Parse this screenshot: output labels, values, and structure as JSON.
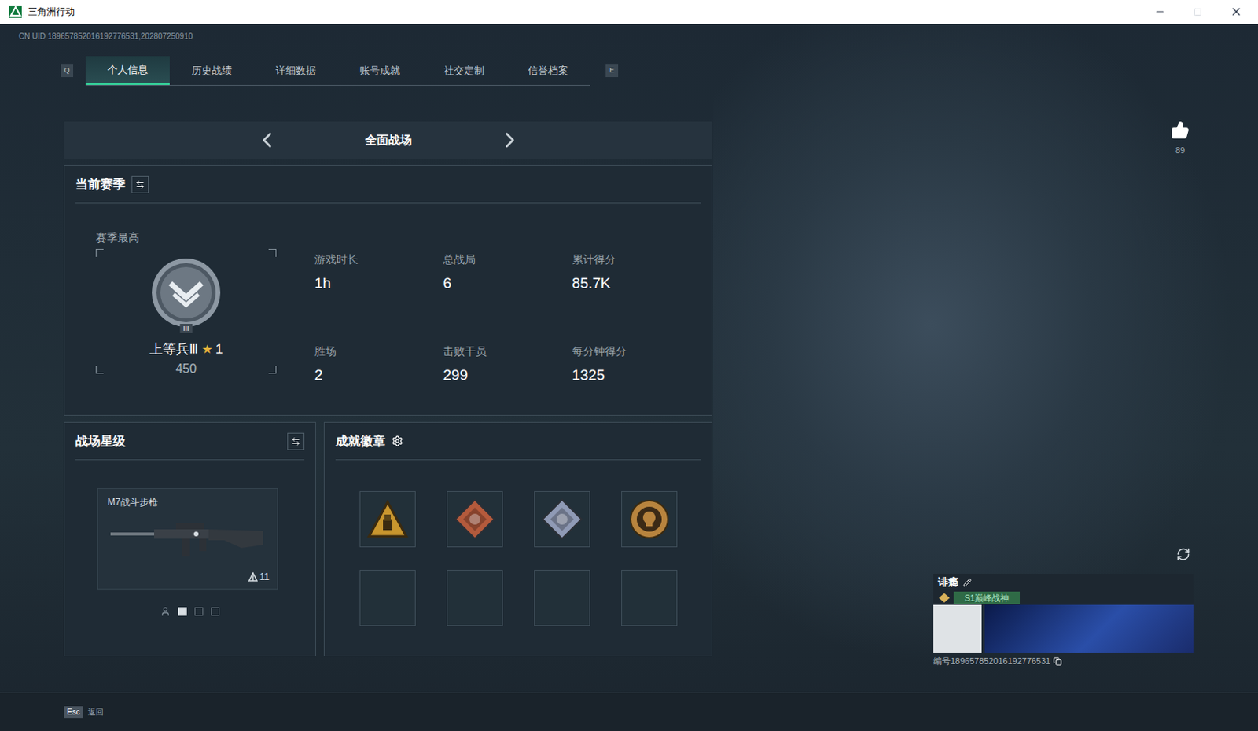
{
  "window": {
    "title": "三角洲行动"
  },
  "uid": "CN UID 189657852016192776531,202807250910",
  "tabs": {
    "prev_key": "Q",
    "next_key": "E",
    "items": [
      {
        "label": "个人信息",
        "selected": true
      },
      {
        "label": "历史战绩",
        "selected": false
      },
      {
        "label": "详细数据",
        "selected": false
      },
      {
        "label": "账号成就",
        "selected": false
      },
      {
        "label": "社交定制",
        "selected": false
      },
      {
        "label": "信誉档案",
        "selected": false
      }
    ]
  },
  "mode": {
    "label": "全面战场"
  },
  "season": {
    "title": "当前赛季",
    "best_label": "赛季最高",
    "rank": "上等兵Ⅲ",
    "rank_tier": "III",
    "star_icon": "★",
    "star_count": "1",
    "score": "450",
    "stats": [
      {
        "label": "游戏时长",
        "value": "1h"
      },
      {
        "label": "总战局",
        "value": "6"
      },
      {
        "label": "累计得分",
        "value": "85.7K"
      },
      {
        "label": "胜场",
        "value": "2"
      },
      {
        "label": "击败干员",
        "value": "299"
      },
      {
        "label": "每分钟得分",
        "value": "1325"
      }
    ]
  },
  "star_panel": {
    "title": "战场星级",
    "weapon": "M7战斗步枪",
    "star_count": "11",
    "pager": [
      {
        "kind": "icon",
        "selected": false
      },
      {
        "kind": "dot",
        "selected": true
      },
      {
        "kind": "dot",
        "selected": false
      },
      {
        "kind": "dot",
        "selected": false
      }
    ]
  },
  "achievements": {
    "title": "成就徽章",
    "badges": [
      {
        "kind": "triangle",
        "color": "#c9962e"
      },
      {
        "kind": "diamond",
        "color": "#b45a3c"
      },
      {
        "kind": "diamond",
        "color": "#8f9ab5"
      },
      {
        "kind": "circle",
        "color": "#b8843e"
      },
      {
        "kind": "empty",
        "color": "#223039"
      },
      {
        "kind": "empty",
        "color": "#223039"
      },
      {
        "kind": "empty",
        "color": "#223039"
      },
      {
        "kind": "empty",
        "color": "#223039"
      }
    ]
  },
  "profile": {
    "likes": "89",
    "name": "诽瘾",
    "title": "S1巅峰战神",
    "id": "编号189657852016192776531"
  },
  "footer": {
    "key": "Esc",
    "label": "返回"
  }
}
